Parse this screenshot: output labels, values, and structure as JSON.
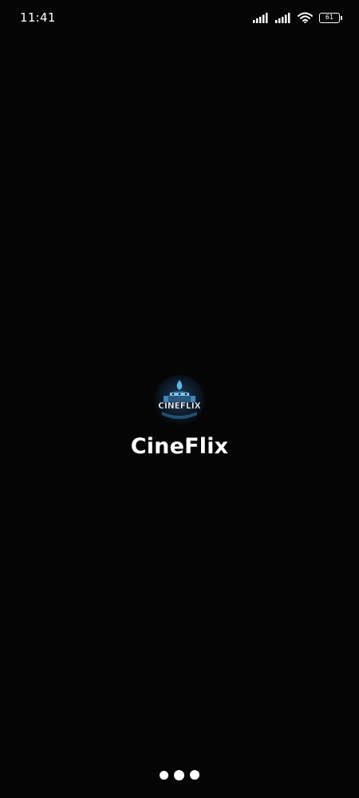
{
  "status_bar": {
    "time": "11:41",
    "battery_level": "61",
    "icons": [
      "signal-icon",
      "signal-icon",
      "wifi-icon",
      "battery-icon"
    ]
  },
  "splash": {
    "logo_text": "CINEFLIX",
    "app_name": "CineFlix"
  },
  "loader": {
    "icon": "loading-dots-icon"
  },
  "colors": {
    "background": "#050505",
    "text": "#ffffff",
    "logo_accent": "#5fb4e8"
  }
}
